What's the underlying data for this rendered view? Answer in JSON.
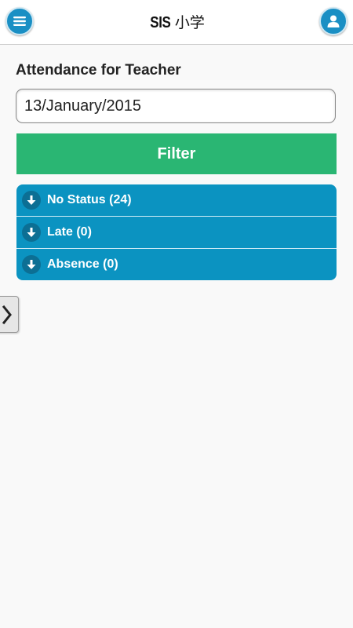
{
  "header": {
    "brand": "SIS",
    "subtitle": "小学",
    "menu_icon": "hamburger-menu-icon",
    "user_icon": "user-profile-icon"
  },
  "page": {
    "heading": "Attendance for Teacher",
    "date_value": "13/January/2015",
    "filter_label": "Filter"
  },
  "statuses": [
    {
      "label": "No Status (24)",
      "icon": "arrow-down-icon"
    },
    {
      "label": "Late (0)",
      "icon": "arrow-down-icon"
    },
    {
      "label": "Absence (0)",
      "icon": "arrow-down-icon"
    }
  ],
  "side_tab": {
    "icon": "chevron-right-icon"
  },
  "colors": {
    "accent_blue": "#0b93c1",
    "filter_green": "#2ab673",
    "header_button": "#1a8fc4"
  }
}
